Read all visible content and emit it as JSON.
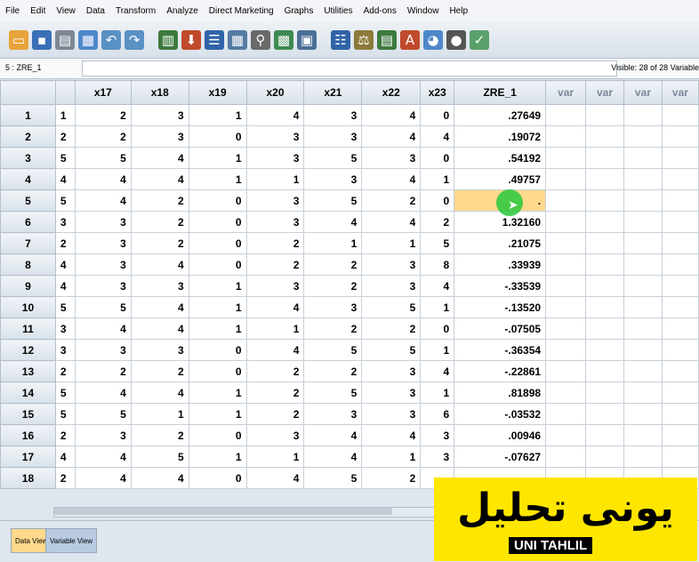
{
  "menu": [
    "File",
    "Edit",
    "View",
    "Data",
    "Transform",
    "Analyze",
    "Direct Marketing",
    "Graphs",
    "Utilities",
    "Add-ons",
    "Window",
    "Help"
  ],
  "cell_ref": "5 : ZRE_1",
  "visible_text": "Visible: 28 of 28 Variable",
  "columns": [
    "x17",
    "x18",
    "x19",
    "x20",
    "x21",
    "x22",
    "x23",
    "ZRE_1",
    "var",
    "var",
    "var",
    "var"
  ],
  "rows": [
    {
      "n": "1",
      "x17": "1",
      "x18": "2",
      "x19": "3",
      "x20": "1",
      "x21": "4",
      "x22": "3",
      "x23": "4",
      "x24": "0",
      "zre": ".27649"
    },
    {
      "n": "2",
      "x17": "2",
      "x18": "2",
      "x19": "3",
      "x20": "0",
      "x21": "3",
      "x22": "3",
      "x23": "4",
      "x24": "4",
      "zre": ".19072"
    },
    {
      "n": "3",
      "x17": "5",
      "x18": "5",
      "x19": "4",
      "x20": "1",
      "x21": "3",
      "x22": "5",
      "x23": "3",
      "x24": "0",
      "zre": ".54192"
    },
    {
      "n": "4",
      "x17": "4",
      "x18": "4",
      "x19": "4",
      "x20": "1",
      "x21": "1",
      "x22": "3",
      "x23": "4",
      "x24": "1",
      "zre": ".49757"
    },
    {
      "n": "5",
      "x17": "5",
      "x18": "4",
      "x19": "2",
      "x20": "0",
      "x21": "3",
      "x22": "5",
      "x23": "2",
      "x24": "0",
      "zre": "."
    },
    {
      "n": "6",
      "x17": "3",
      "x18": "3",
      "x19": "2",
      "x20": "0",
      "x21": "3",
      "x22": "4",
      "x23": "4",
      "x24": "2",
      "zre": "1.32160"
    },
    {
      "n": "7",
      "x17": "2",
      "x18": "3",
      "x19": "2",
      "x20": "0",
      "x21": "2",
      "x22": "1",
      "x23": "1",
      "x24": "5",
      "zre": ".21075"
    },
    {
      "n": "8",
      "x17": "4",
      "x18": "3",
      "x19": "4",
      "x20": "0",
      "x21": "2",
      "x22": "2",
      "x23": "3",
      "x24": "8",
      "zre": ".33939"
    },
    {
      "n": "9",
      "x17": "4",
      "x18": "3",
      "x19": "3",
      "x20": "1",
      "x21": "3",
      "x22": "2",
      "x23": "3",
      "x24": "4",
      "zre": "-.33539"
    },
    {
      "n": "10",
      "x17": "5",
      "x18": "5",
      "x19": "4",
      "x20": "1",
      "x21": "4",
      "x22": "3",
      "x23": "5",
      "x24": "1",
      "zre": "-.13520"
    },
    {
      "n": "11",
      "x17": "3",
      "x18": "4",
      "x19": "4",
      "x20": "1",
      "x21": "1",
      "x22": "2",
      "x23": "2",
      "x24": "0",
      "zre": "-.07505"
    },
    {
      "n": "12",
      "x17": "3",
      "x18": "3",
      "x19": "3",
      "x20": "0",
      "x21": "4",
      "x22": "5",
      "x23": "5",
      "x24": "1",
      "zre": "-.36354"
    },
    {
      "n": "13",
      "x17": "2",
      "x18": "2",
      "x19": "2",
      "x20": "0",
      "x21": "2",
      "x22": "2",
      "x23": "3",
      "x24": "4",
      "zre": "-.22861"
    },
    {
      "n": "14",
      "x17": "5",
      "x18": "4",
      "x19": "4",
      "x20": "1",
      "x21": "2",
      "x22": "5",
      "x23": "3",
      "x24": "1",
      "zre": ".81898"
    },
    {
      "n": "15",
      "x17": "5",
      "x18": "5",
      "x19": "1",
      "x20": "1",
      "x21": "2",
      "x22": "3",
      "x23": "3",
      "x24": "6",
      "zre": "-.03532"
    },
    {
      "n": "16",
      "x17": "2",
      "x18": "3",
      "x19": "2",
      "x20": "0",
      "x21": "3",
      "x22": "4",
      "x23": "4",
      "x24": "3",
      "zre": ".00946"
    },
    {
      "n": "17",
      "x17": "4",
      "x18": "4",
      "x19": "5",
      "x20": "1",
      "x21": "1",
      "x22": "4",
      "x23": "1",
      "x24": "3",
      "zre": "-.07627"
    },
    {
      "n": "18",
      "x17": "2",
      "x18": "4",
      "x19": "4",
      "x20": "0",
      "x21": "4",
      "x22": "5",
      "x23": "2",
      "x24": "",
      "zre": ""
    }
  ],
  "tabs": {
    "data_view": "Data View",
    "variable_view": "Variable View"
  },
  "logo": {
    "arabic": "يونی تحلیل",
    "english": "UNI TAHLIL"
  },
  "colors": {
    "selected_cell": "#ffd98c",
    "logo_bg": "#ffe600",
    "header_bg": "#d9e1ea"
  }
}
